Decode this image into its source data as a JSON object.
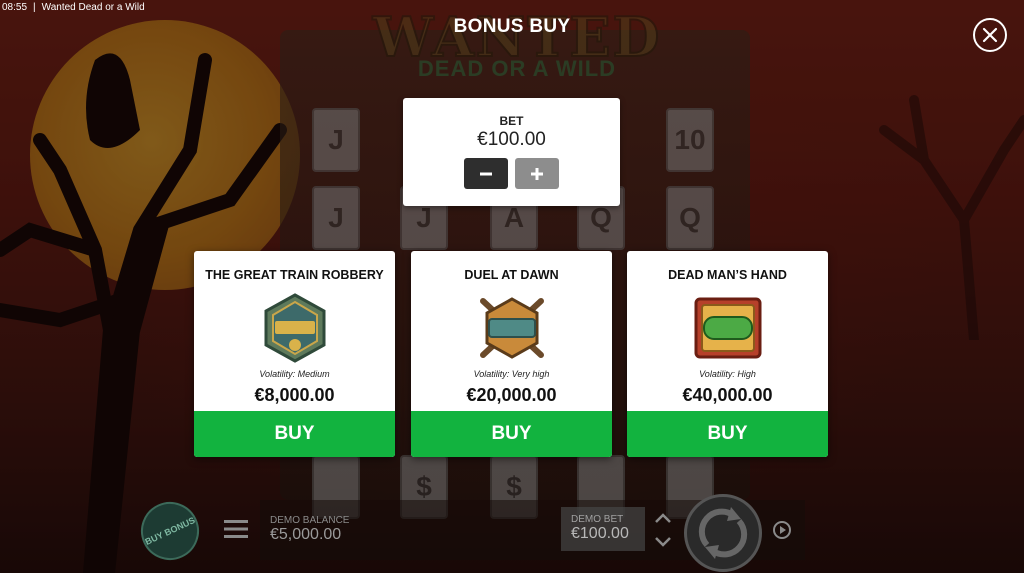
{
  "status_bar": {
    "time": "08:55",
    "window_title": "Wanted Dead or a Wild"
  },
  "game_logo": {
    "line1": "WANTED",
    "line2": "DEAD OR A WILD"
  },
  "dialog": {
    "title": "BONUS BUY",
    "close_icon": "close-circle-icon"
  },
  "bet": {
    "label": "BET",
    "value": "€100.00",
    "minus_icon": "minus-icon",
    "plus_icon": "plus-icon"
  },
  "bonus_options": [
    {
      "title": "THE GREAT TRAIN ROBBERY",
      "icon": "great-train-robbery-badge-icon",
      "volatility": "Volatility: Medium",
      "price": "€8,000.00",
      "buy_label": "BUY"
    },
    {
      "title": "DUEL AT DAWN",
      "icon": "duel-badge-icon",
      "volatility": "Volatility: Very high",
      "price": "€20,000.00",
      "buy_label": "BUY"
    },
    {
      "title": "DEAD MAN’S HAND",
      "icon": "dead-badge-icon",
      "volatility": "Volatility: High",
      "price": "€40,000.00",
      "buy_label": "BUY"
    }
  ],
  "footer": {
    "buy_bonus_label": "BUY BONUS",
    "demo_balance_label": "DEMO BALANCE",
    "demo_balance_value": "€5,000.00",
    "demo_bet_label": "DEMO BET",
    "demo_bet_value": "€100.00"
  },
  "colors": {
    "buy_green": "#12b33f",
    "panel_white": "#ffffff",
    "minus_bg": "#2e2e2e",
    "plus_bg": "#8d8d8d"
  }
}
